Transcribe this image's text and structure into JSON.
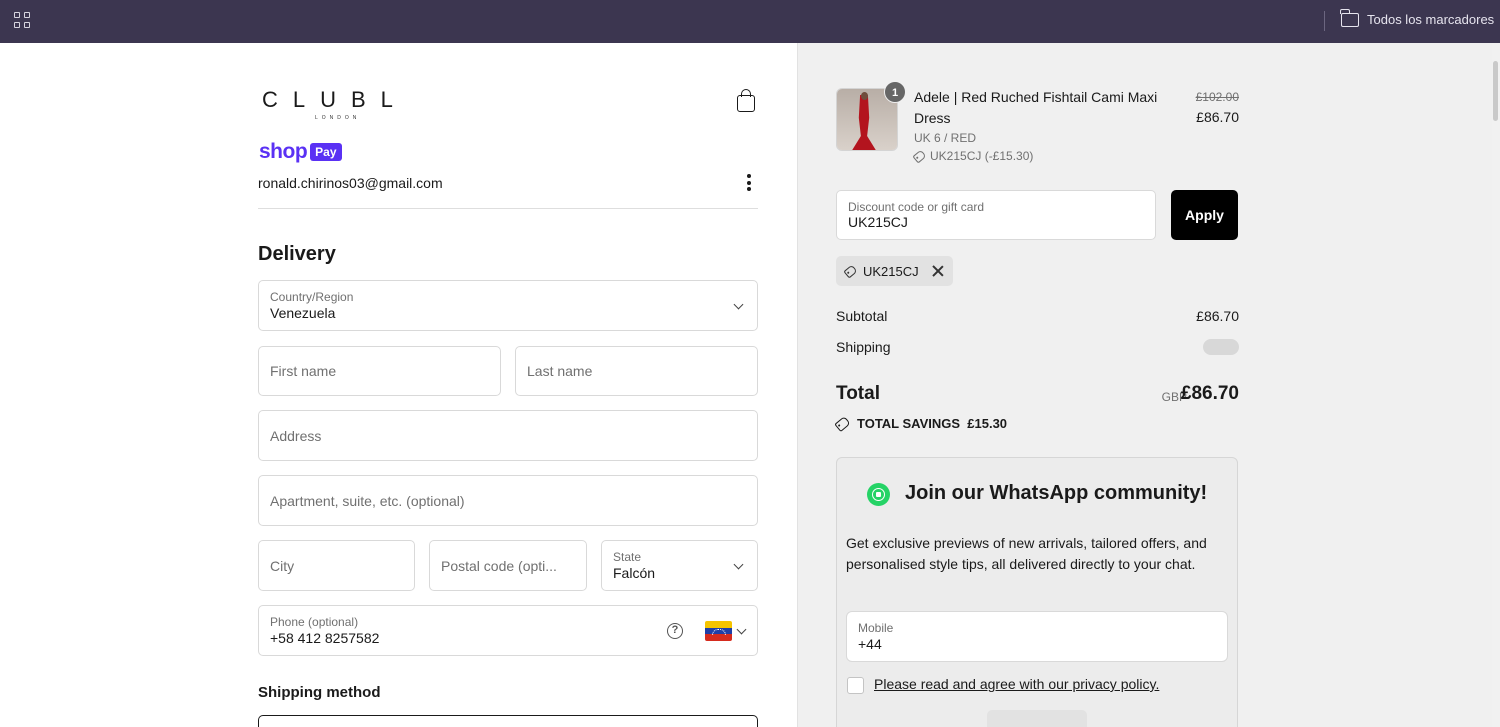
{
  "browser": {
    "bookmarks_folder": "Todos los marcadores"
  },
  "brand": {
    "logo": "CLUBL",
    "logo_sub": "LONDON"
  },
  "shop_pay": {
    "shop_word": "shop",
    "pay_badge": "Pay",
    "email": "ronald.chirinos03@gmail.com"
  },
  "delivery": {
    "heading": "Delivery",
    "country": {
      "label": "Country/Region",
      "value": "Venezuela"
    },
    "first_name": {
      "placeholder": "First name"
    },
    "last_name": {
      "placeholder": "Last name"
    },
    "address": {
      "placeholder": "Address"
    },
    "apartment": {
      "placeholder": "Apartment, suite, etc. (optional)"
    },
    "city": {
      "placeholder": "City"
    },
    "postal": {
      "placeholder": "Postal code (opti..."
    },
    "state": {
      "label": "State",
      "value": "Falcón"
    },
    "phone": {
      "label": "Phone (optional)",
      "value": "+58 412 8257582",
      "help": "?"
    },
    "shipping_method_heading": "Shipping method"
  },
  "summary": {
    "item": {
      "quantity": "1",
      "name": "Adele | Red Ruched Fishtail Cami Maxi Dress",
      "variant": "UK 6 / RED",
      "discount": "UK215CJ (-£15.30)",
      "original_price": "£102.00",
      "price": "£86.70"
    },
    "discount_field": {
      "label": "Discount code or gift card",
      "value": "UK215CJ"
    },
    "apply_label": "Apply",
    "applied_code": "UK215CJ",
    "subtotal_label": "Subtotal",
    "subtotal_value": "£86.70",
    "shipping_label": "Shipping",
    "total_label": "Total",
    "total_currency": "GBP",
    "total_value": "£86.70",
    "savings": "TOTAL SAVINGS  £15.30"
  },
  "whatsapp": {
    "title": "Join our WhatsApp community!",
    "text": "Get exclusive previews of new arrivals, tailored offers, and personalised style tips, all delivered directly to your chat.",
    "mobile": {
      "label": "Mobile",
      "value": "+44"
    },
    "policy": "Please read and agree with our privacy policy."
  },
  "colors": {
    "topbar": "#3c3650",
    "shop_pay": "#5a31f4",
    "summary_bg": "#f0f0f0",
    "whatsapp": "#25d366",
    "apply": "#000000"
  }
}
